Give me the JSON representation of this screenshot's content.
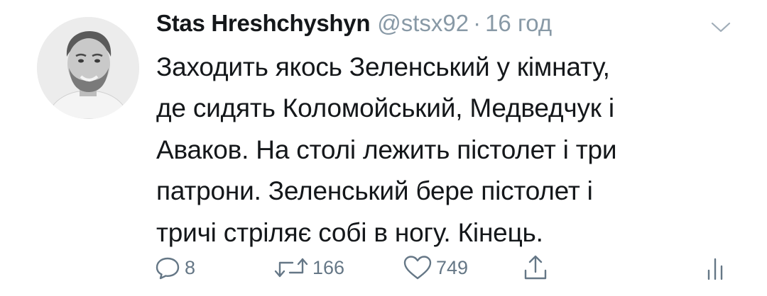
{
  "tweet": {
    "display_name": "Stas Hreshchyshyn",
    "handle": "@stsx92",
    "separator": "·",
    "time": "16 год",
    "text_lines": [
      "Заходить якось Зеленський у кімнату,",
      "де сидять Коломойський, Медведчук і",
      "Аваков. На столі лежить пістолет і три",
      "патрони. Зеленський бере пістолет і",
      "тричі стріляє собі в ногу. Кінець."
    ],
    "actions": {
      "reply_count": "8",
      "retweet_count": "166",
      "like_count": "749"
    },
    "icons": {
      "menu": "chevron-down-icon",
      "reply": "speech-bubble-icon",
      "retweet": "retweet-arrows-icon",
      "like": "heart-icon",
      "share": "share-upload-icon",
      "analytics": "bar-chart-icon"
    },
    "colors": {
      "text": "#14171a",
      "secondary": "#8899a6",
      "icon": "#657786"
    }
  }
}
